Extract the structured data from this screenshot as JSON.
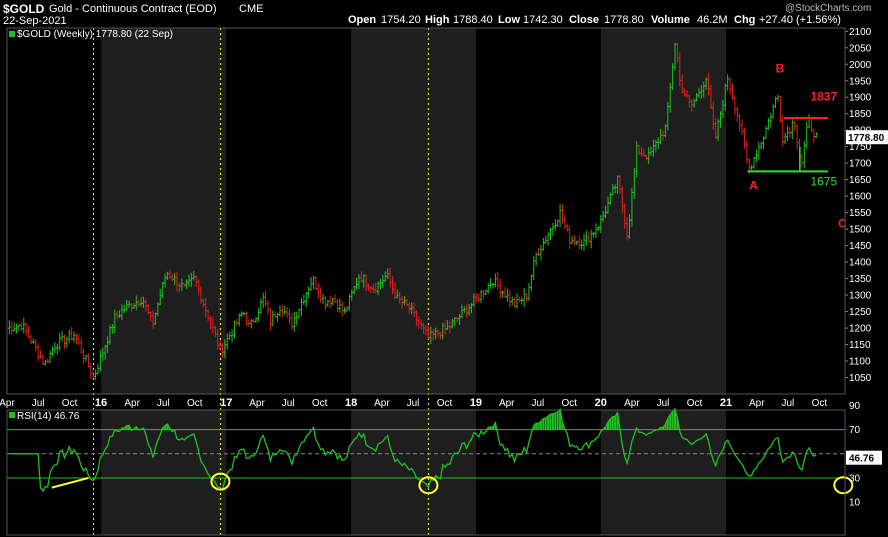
{
  "header": {
    "symbol": "$GOLD",
    "name": "Gold - Continuous Contract (EOD)",
    "exchange": "CME",
    "date": "22-Sep-2021",
    "watermark": "@StockCharts.com",
    "open_label": "Open",
    "open": "1754.20",
    "high_label": "High",
    "high": "1788.40",
    "low_label": "Low",
    "low": "1742.30",
    "close_label": "Close",
    "close": "1778.80",
    "volume_label": "Volume",
    "volume": "46.2M",
    "chg_label": "Chg",
    "chg": "+27.40 (+1.56%)",
    "legend_price": "$GOLD (Weekly) 1778.80 (22 Sep)",
    "legend_rsi": "RSI(14) 46.76"
  },
  "colors": {
    "up": "#22c022",
    "down": "#e02020",
    "rsi": "#22c022",
    "annot": "#ff2020",
    "support": "#33dd33",
    "yellow": "#ffff33",
    "panel": "#000000",
    "band": "#1e1e1e"
  },
  "chart_data": [
    {
      "type": "candlestick",
      "title": "$GOLD (Weekly) 1778.80 (22 Sep)",
      "ylim": [
        1000,
        2110
      ],
      "y_ticks": [
        1050,
        1100,
        1150,
        1200,
        1250,
        1300,
        1350,
        1400,
        1450,
        1500,
        1550,
        1600,
        1650,
        1700,
        1750,
        1800,
        1850,
        1900,
        1950,
        2000,
        2050,
        2100
      ],
      "last_value_label": "1778.80",
      "x_tick_labels": [
        "Apr",
        "Jul",
        "Oct",
        "16",
        "Apr",
        "Jul",
        "Oct",
        "17",
        "Apr",
        "Jul",
        "Oct",
        "18",
        "Apr",
        "Jul",
        "Oct",
        "19",
        "Apr",
        "Jul",
        "Oct",
        "20",
        "Apr",
        "Jul",
        "Oct",
        "21",
        "Apr",
        "Jul",
        "Oct"
      ],
      "x_tick_dates": [
        "2015-04",
        "2015-07",
        "2015-10",
        "2016-01",
        "2016-04",
        "2016-07",
        "2016-10",
        "2017-01",
        "2017-04",
        "2017-07",
        "2017-10",
        "2018-01",
        "2018-04",
        "2018-07",
        "2018-10",
        "2019-01",
        "2019-04",
        "2019-07",
        "2019-10",
        "2020-01",
        "2020-04",
        "2020-07",
        "2020-10",
        "2021-01",
        "2021-04",
        "2021-07",
        "2021-10"
      ],
      "x_range": [
        "2015-04-01",
        "2021-12-15"
      ],
      "shaded_years": [
        2016,
        2018,
        2020
      ],
      "vertical_markers": [
        "2015-12-10",
        "2016-12-15",
        "2018-08-15"
      ],
      "price_path": [
        [
          "2015-04-01",
          1200
        ],
        [
          "2015-05-15",
          1210
        ],
        [
          "2015-07-20",
          1090
        ],
        [
          "2015-08-20",
          1150
        ],
        [
          "2015-10-15",
          1180
        ],
        [
          "2015-12-10",
          1050
        ],
        [
          "2016-02-10",
          1230
        ],
        [
          "2016-03-10",
          1260
        ],
        [
          "2016-05-01",
          1290
        ],
        [
          "2016-05-30",
          1210
        ],
        [
          "2016-07-10",
          1370
        ],
        [
          "2016-09-01",
          1320
        ],
        [
          "2016-09-30",
          1350
        ],
        [
          "2016-11-15",
          1220
        ],
        [
          "2016-12-15",
          1130
        ],
        [
          "2017-02-20",
          1250
        ],
        [
          "2017-03-10",
          1200
        ],
        [
          "2017-04-20",
          1290
        ],
        [
          "2017-05-10",
          1220
        ],
        [
          "2017-06-10",
          1270
        ],
        [
          "2017-07-10",
          1210
        ],
        [
          "2017-09-10",
          1350
        ],
        [
          "2017-10-15",
          1280
        ],
        [
          "2017-11-10",
          1290
        ],
        [
          "2017-12-12",
          1245
        ],
        [
          "2018-01-25",
          1360
        ],
        [
          "2018-03-10",
          1320
        ],
        [
          "2018-04-15",
          1360
        ],
        [
          "2018-05-15",
          1290
        ],
        [
          "2018-06-20",
          1260
        ],
        [
          "2018-08-15",
          1170
        ],
        [
          "2018-10-10",
          1200
        ],
        [
          "2018-12-31",
          1285
        ],
        [
          "2019-02-20",
          1345
        ],
        [
          "2019-04-25",
          1270
        ],
        [
          "2019-05-30",
          1300
        ],
        [
          "2019-06-25",
          1420
        ],
        [
          "2019-09-04",
          1550
        ],
        [
          "2019-10-01",
          1470
        ],
        [
          "2019-11-15",
          1460
        ],
        [
          "2019-12-31",
          1520
        ],
        [
          "2020-02-20",
          1650
        ],
        [
          "2020-03-19",
          1480
        ],
        [
          "2020-04-15",
          1740
        ],
        [
          "2020-05-20",
          1720
        ],
        [
          "2020-07-10",
          1810
        ],
        [
          "2020-08-06",
          2075
        ],
        [
          "2020-08-20",
          1940
        ],
        [
          "2020-09-20",
          1870
        ],
        [
          "2020-11-05",
          1960
        ],
        [
          "2020-11-30",
          1770
        ],
        [
          "2021-01-06",
          1960
        ],
        [
          "2021-02-10",
          1820
        ],
        [
          "2021-03-08",
          1680
        ],
        [
          "2021-04-20",
          1780
        ],
        [
          "2021-06-01",
          1910
        ],
        [
          "2021-06-17",
          1770
        ],
        [
          "2021-07-20",
          1830
        ],
        [
          "2021-08-09",
          1690
        ],
        [
          "2021-08-30",
          1830
        ],
        [
          "2021-09-22",
          1779
        ]
      ],
      "annotations": [
        {
          "text": "B",
          "date": "2021-05-26",
          "y": 1975
        },
        {
          "text": "1837",
          "date": "2021-09-05",
          "y": 1890
        },
        {
          "text": "A",
          "date": "2021-03-10",
          "y": 1620
        },
        {
          "text": "1675",
          "date": "2021-09-05",
          "y": 1632
        },
        {
          "text": "C",
          "date": "2021-11-25",
          "y": 1505
        }
      ],
      "resistance": {
        "value": 1837,
        "from": "2021-06-20",
        "to": "2021-10-26"
      },
      "support": {
        "value": 1675,
        "from": "2021-03-05",
        "to": "2021-10-26"
      }
    },
    {
      "type": "line",
      "title": "RSI(14) 46.76",
      "ylim": [
        0,
        100
      ],
      "y_ticks": [
        10,
        30,
        50,
        70,
        90
      ],
      "last_value_label": "46.76",
      "reference_lines": [
        70,
        50,
        30
      ],
      "series_values_from": "price_path",
      "trendline": [
        [
          "2015-08-10",
          22
        ],
        [
          "2015-11-25",
          30
        ]
      ],
      "circles": [
        {
          "date": "2016-12-15",
          "y": 27
        },
        {
          "date": "2018-08-15",
          "y": 24
        },
        {
          "date": "2021-12-10",
          "y": 24
        }
      ]
    }
  ]
}
